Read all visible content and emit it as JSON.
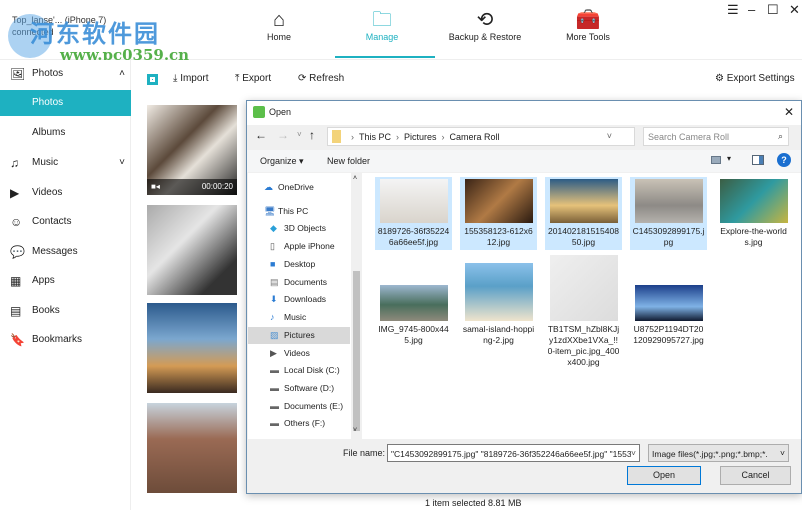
{
  "device": {
    "name": "Top_lanse'... (iPhone 7)",
    "status": "connected"
  },
  "watermark": {
    "text": "河东软件园",
    "url": "www.pc0359.cn"
  },
  "nav": {
    "tabs": [
      {
        "label": "Home",
        "icon": "⌂"
      },
      {
        "label": "Manage",
        "icon": "🗀"
      },
      {
        "label": "Backup & Restore",
        "icon": "⟲"
      },
      {
        "label": "More Tools",
        "icon": "🧰"
      }
    ],
    "active": "Manage"
  },
  "window": {
    "menu": "☰",
    "minimize": "–",
    "maximize": "☐",
    "close": "✕"
  },
  "sidebar": {
    "header": {
      "label": "Photos",
      "icon": "🖼",
      "chevron": "˄"
    },
    "items": [
      {
        "label": "Photos",
        "icon": "",
        "active": true,
        "sub": true
      },
      {
        "label": "Albums",
        "icon": "",
        "sub": true
      },
      {
        "label": "Music",
        "icon": "♫",
        "chevron": "˅"
      },
      {
        "label": "Videos",
        "icon": "▶"
      },
      {
        "label": "Contacts",
        "icon": "☺"
      },
      {
        "label": "Messages",
        "icon": "💬"
      },
      {
        "label": "Apps",
        "icon": "▦"
      },
      {
        "label": "Books",
        "icon": "▤"
      },
      {
        "label": "Bookmarks",
        "icon": "🔖"
      }
    ]
  },
  "toolbar": {
    "import": "Import",
    "export": "Export",
    "refresh": "Refresh",
    "export_settings": "Export Settings"
  },
  "gallery": {
    "video_duration": "00:00:20"
  },
  "dialog": {
    "title": "Open",
    "breadcrumb": [
      "This PC",
      "Pictures",
      "Camera Roll"
    ],
    "search_placeholder": "Search Camera Roll",
    "organize": "Organize ▾",
    "new_folder": "New folder",
    "tree": [
      {
        "label": "OneDrive",
        "icon": "☁",
        "top": true,
        "color": "#2b7cd3"
      },
      {
        "label": "This PC",
        "icon": "🖥",
        "top": true,
        "color": "#3a7bc8"
      },
      {
        "label": "3D Objects",
        "icon": "◆",
        "color": "#2aa0d8"
      },
      {
        "label": "Apple iPhone",
        "icon": "▯",
        "color": "#555"
      },
      {
        "label": "Desktop",
        "icon": "■",
        "color": "#2b7cd3"
      },
      {
        "label": "Documents",
        "icon": "▤",
        "color": "#777"
      },
      {
        "label": "Downloads",
        "icon": "⬇",
        "color": "#2b7cd3"
      },
      {
        "label": "Music",
        "icon": "♪",
        "color": "#2b7cd3"
      },
      {
        "label": "Pictures",
        "icon": "▨",
        "color": "#4a8fd0",
        "selected": true
      },
      {
        "label": "Videos",
        "icon": "▶",
        "color": "#555"
      },
      {
        "label": "Local Disk (C:)",
        "icon": "▬",
        "color": "#666"
      },
      {
        "label": "Software (D:)",
        "icon": "▬",
        "color": "#666"
      },
      {
        "label": "Documents (E:)",
        "icon": "▬",
        "color": "#666"
      },
      {
        "label": "Others (F:)",
        "icon": "▬",
        "color": "#666"
      }
    ],
    "files": [
      {
        "name": "8189726-36f352246a66ee5f.jpg",
        "selected": true,
        "img": "linear-gradient(#f4f4f4,#d9d4cc)"
      },
      {
        "name": "155358123-612x612.jpg",
        "selected": true,
        "img": "linear-gradient(135deg,#3a2416,#b07a45,#2a1a10)"
      },
      {
        "name": "20140218151540850.jpg",
        "selected": true,
        "img": "linear-gradient(#2d5c86,#e6c27a 60%,#7a6038)"
      },
      {
        "name": "C1453092899175.jpg",
        "selected": true,
        "img": "linear-gradient(#c9c2b6,#8d8a86 60%,#b5b2ad)"
      },
      {
        "name": "Explore-the-worlds.jpg",
        "selected": false,
        "img": "linear-gradient(135deg,#3b5e44,#2f9aa0,#c7b540)"
      },
      {
        "name": "IMG_9745-800x445.jpg",
        "selected": false,
        "img": "linear-gradient(#9db7d0,#496e5c 55%,#8e8a7c)"
      },
      {
        "name": "samal-island-hopping-2.jpg",
        "selected": false,
        "img": "linear-gradient(#8bc1ea,#5aa0c8 40%,#efe4cc)"
      },
      {
        "name": "TB1TSM_hZbl8KJjy1zdXXbe1VXa_!!0-item_pic.jpg_400x400.jpg",
        "selected": false,
        "img": "linear-gradient(135deg,#efefef,#dcdcdc)"
      },
      {
        "name": "U8752P1194DT20120929095727.jpg",
        "selected": false,
        "img": "linear-gradient(#1c3f8a,#7fb2e6 60%,#101a30)"
      }
    ],
    "file_name_label": "File name:",
    "file_name_value": "\"C1453092899175.jpg\" \"8189726-36f352246a66ee5f.jpg\" \"1553",
    "filter": "Image files(*.jpg;*.png;*.bmp;*.",
    "open": "Open",
    "cancel": "Cancel"
  },
  "status": "1 item selected 8.81 MB",
  "colors": {
    "accent": "#1eb1c1",
    "selection": "#cce8ff"
  }
}
